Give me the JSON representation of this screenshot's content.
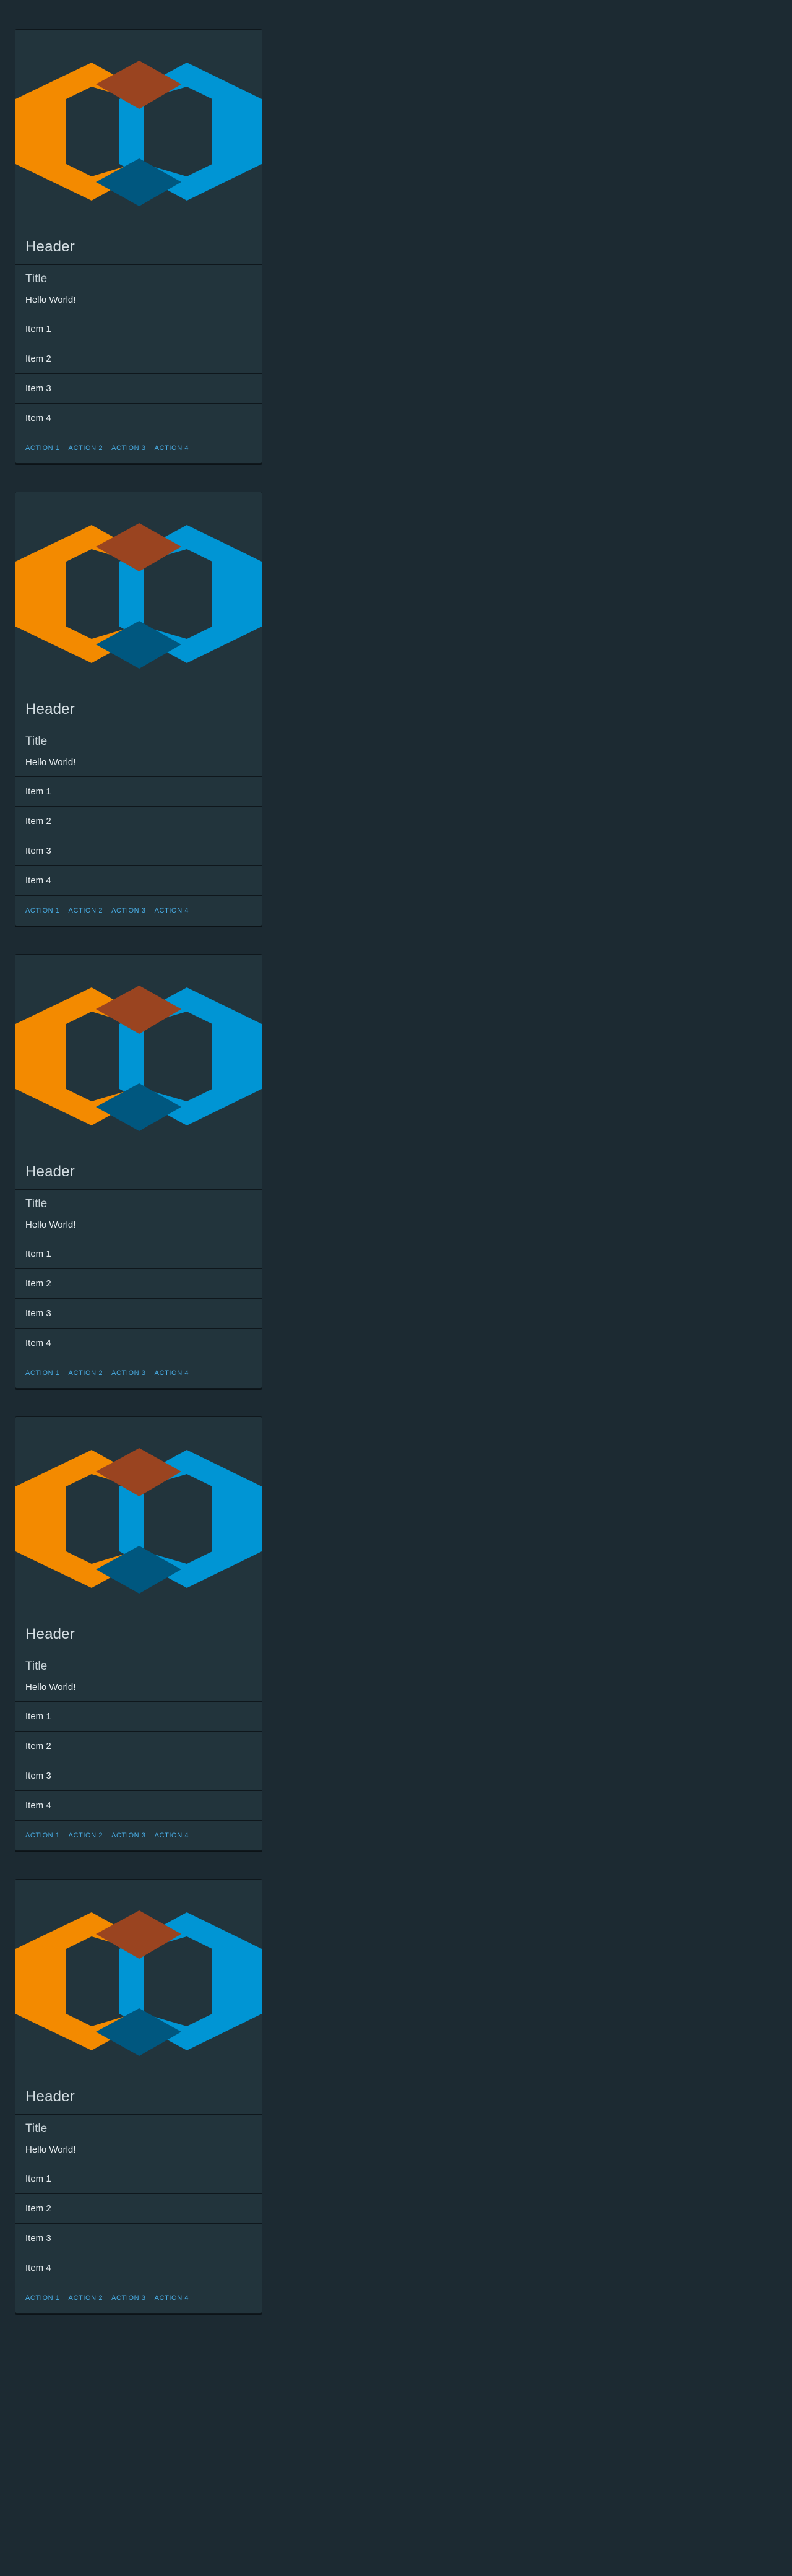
{
  "cards": [
    {
      "header": "Header",
      "title": "Title",
      "text": "Hello World!",
      "items": [
        "Item 1",
        "Item 2",
        "Item 3",
        "Item 4"
      ],
      "actions": [
        "ACTION 1",
        "ACTION 2",
        "ACTION 3",
        "ACTION 4"
      ]
    },
    {
      "header": "Header",
      "title": "Title",
      "text": "Hello World!",
      "items": [
        "Item 1",
        "Item 2",
        "Item 3",
        "Item 4"
      ],
      "actions": [
        "ACTION 1",
        "ACTION 2",
        "ACTION 3",
        "ACTION 4"
      ]
    },
    {
      "header": "Header",
      "title": "Title",
      "text": "Hello World!",
      "items": [
        "Item 1",
        "Item 2",
        "Item 3",
        "Item 4"
      ],
      "actions": [
        "ACTION 1",
        "ACTION 2",
        "ACTION 3",
        "ACTION 4"
      ]
    },
    {
      "header": "Header",
      "title": "Title",
      "text": "Hello World!",
      "items": [
        "Item 1",
        "Item 2",
        "Item 3",
        "Item 4"
      ],
      "actions": [
        "ACTION 1",
        "ACTION 2",
        "ACTION 3",
        "ACTION 4"
      ]
    },
    {
      "header": "Header",
      "title": "Title",
      "text": "Hello World!",
      "items": [
        "Item 1",
        "Item 2",
        "Item 3",
        "Item 4"
      ],
      "actions": [
        "ACTION 1",
        "ACTION 2",
        "ACTION 3",
        "ACTION 4"
      ]
    }
  ],
  "colors": {
    "page_background": "#1c2a32",
    "card_background": "#22343c",
    "divider": "#0f171c",
    "logo_orange": "#f38a00",
    "logo_blue": "#0095d4",
    "overlap_top": "#9a4420",
    "overlap_bottom": "#00577f",
    "action_text": "#49aee6"
  },
  "icons": {
    "media": "hexagon-logo-icon"
  }
}
